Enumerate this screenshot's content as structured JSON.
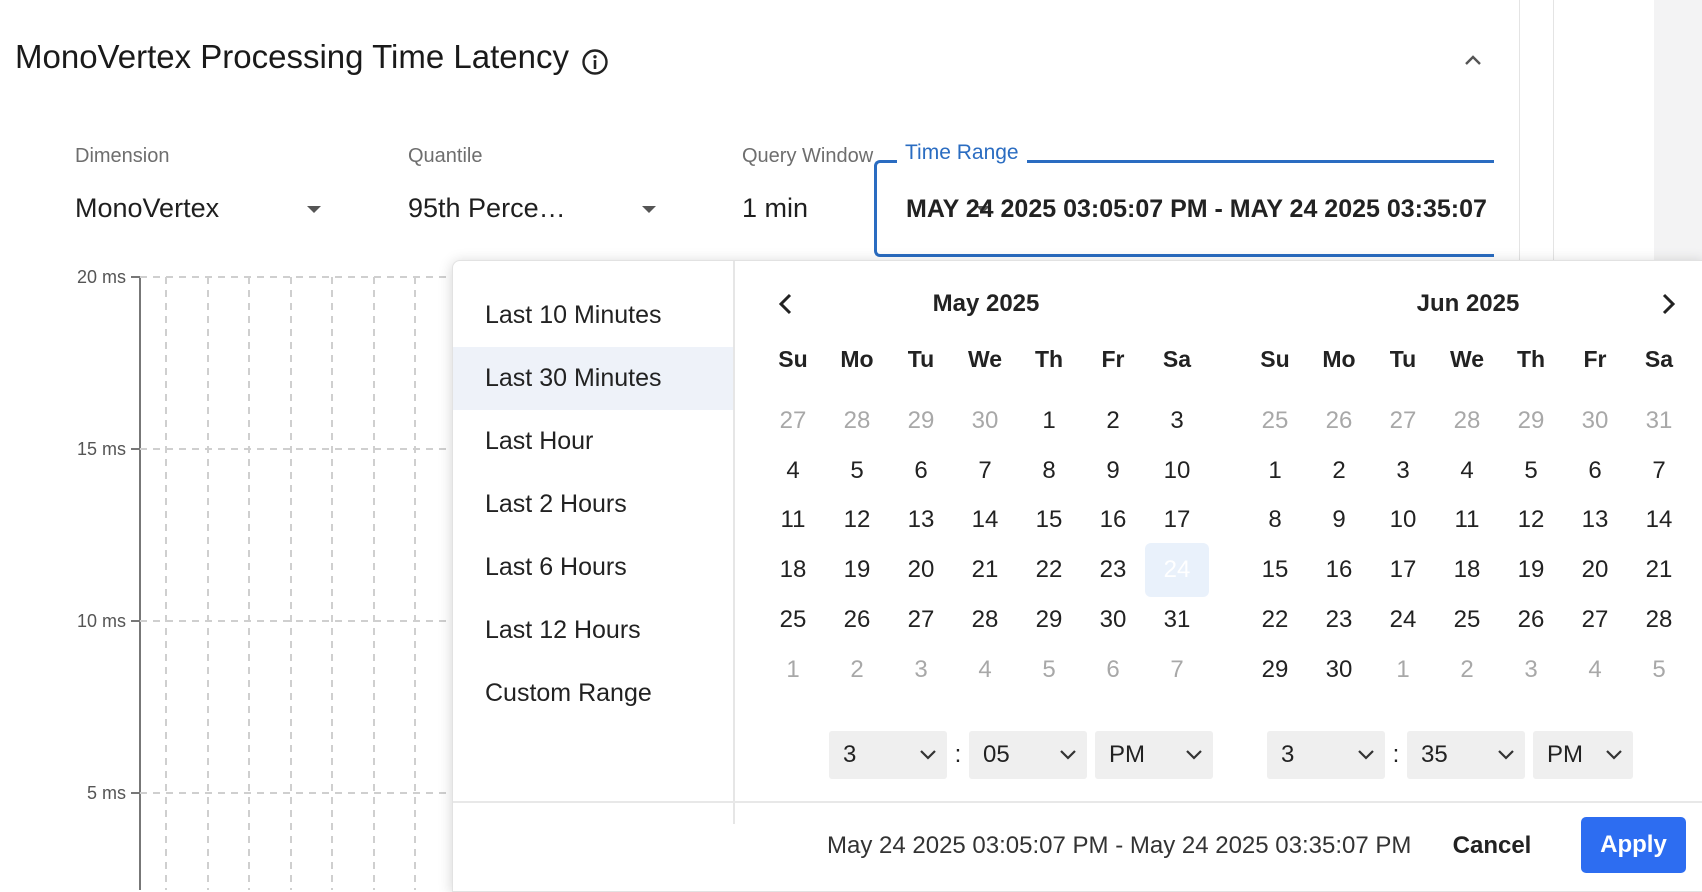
{
  "panel": {
    "title": "MonoVertex Processing Time Latency",
    "info_icon": "info-circle-icon",
    "collapse_icon": "chevron-up-icon"
  },
  "filters": {
    "dimension": {
      "label": "Dimension",
      "value": "MonoVertex"
    },
    "quantile": {
      "label": "Quantile",
      "value": "95th Perce…"
    },
    "query_window": {
      "label": "Query Window",
      "value": "1 min"
    },
    "time_range": {
      "label": "Time Range",
      "value": "MAY 24 2025 03:05:07 PM - MAY 24 2025 03:35:07"
    }
  },
  "chart_data": {
    "type": "line",
    "title": "",
    "xlabel": "",
    "ylabel": "",
    "y_ticks": [
      "20 ms",
      "15 ms",
      "10 ms",
      "5 ms"
    ],
    "y_tick_values": [
      20,
      15,
      10,
      5
    ],
    "grid": true,
    "series": []
  },
  "picker": {
    "presets": [
      "Last 10 Minutes",
      "Last 30 Minutes",
      "Last Hour",
      "Last 2 Hours",
      "Last 6 Hours",
      "Last 12 Hours",
      "Custom Range"
    ],
    "active_preset": "Last 30 Minutes",
    "weekdays": [
      "Su",
      "Mo",
      "Tu",
      "We",
      "Th",
      "Fr",
      "Sa"
    ],
    "left_month": {
      "title": "May 2025",
      "weeks": [
        [
          "27",
          "28",
          "29",
          "30",
          "1",
          "2",
          "3"
        ],
        [
          "4",
          "5",
          "6",
          "7",
          "8",
          "9",
          "10"
        ],
        [
          "11",
          "12",
          "13",
          "14",
          "15",
          "16",
          "17"
        ],
        [
          "18",
          "19",
          "20",
          "21",
          "22",
          "23",
          "24"
        ],
        [
          "25",
          "26",
          "27",
          "28",
          "29",
          "30",
          "31"
        ],
        [
          "1",
          "2",
          "3",
          "4",
          "5",
          "6",
          "7"
        ]
      ],
      "selected_day": "24",
      "time": {
        "hour": "3",
        "minute": "05",
        "ampm": "PM"
      }
    },
    "right_month": {
      "title": "Jun 2025",
      "weeks": [
        [
          "25",
          "26",
          "27",
          "28",
          "29",
          "30",
          "31"
        ],
        [
          "1",
          "2",
          "3",
          "4",
          "5",
          "6",
          "7"
        ],
        [
          "8",
          "9",
          "10",
          "11",
          "12",
          "13",
          "14"
        ],
        [
          "15",
          "16",
          "17",
          "18",
          "19",
          "20",
          "21"
        ],
        [
          "22",
          "23",
          "24",
          "25",
          "26",
          "27",
          "28"
        ],
        [
          "29",
          "30",
          "1",
          "2",
          "3",
          "4",
          "5"
        ]
      ],
      "time": {
        "hour": "3",
        "minute": "35",
        "ampm": "PM"
      }
    },
    "time_separator": ":",
    "nav_prev_icon": "chevron-left-icon",
    "nav_next_icon": "chevron-right-icon",
    "footer_range": "May 24 2025 03:05:07 PM - May 24 2025 03:35:07 PM",
    "cancel_label": "Cancel",
    "apply_label": "Apply",
    "accent_color": "#2d6df1",
    "outline_color": "#2a6cc1"
  }
}
